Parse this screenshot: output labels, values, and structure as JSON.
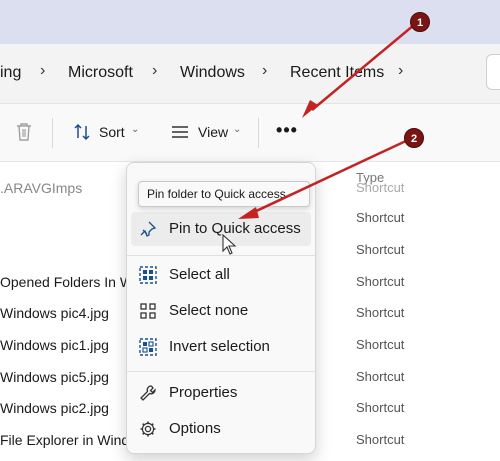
{
  "breadcrumb": {
    "items": [
      "ing",
      "Microsoft",
      "Windows",
      "Recent Items"
    ]
  },
  "toolbar": {
    "sort_label": "Sort",
    "view_label": "View",
    "more_label": "•••"
  },
  "columns": {
    "type": "Type"
  },
  "files": [
    {
      "name": "",
      "type": "Shortcut"
    },
    {
      "name": "",
      "type": "Shortcut"
    },
    {
      "name": "",
      "type": "Shortcut"
    },
    {
      "name": "Opened Folders In W",
      "type": "Shortcut"
    },
    {
      "name": "Windows pic4.jpg",
      "type": "Shortcut"
    },
    {
      "name": "Windows pic1.jpg",
      "type": "Shortcut"
    },
    {
      "name": "Windows pic5.jpg",
      "type": "Shortcut"
    },
    {
      "name": "Windows pic2.jpg",
      "type": "Shortcut"
    },
    {
      "name": "File Explorer in Windo",
      "type": "Shortcut"
    }
  ],
  "context_menu": {
    "tooltip": "Pin folder to Quick access",
    "items": [
      {
        "label": "Pin to Quick access",
        "icon": "pin-icon"
      },
      {
        "label": "Select all",
        "icon": "select-all-icon"
      },
      {
        "label": "Select none",
        "icon": "select-none-icon"
      },
      {
        "label": "Invert selection",
        "icon": "invert-selection-icon"
      },
      {
        "label": "Properties",
        "icon": "wrench-icon"
      },
      {
        "label": "Options",
        "icon": "gear-icon"
      }
    ]
  },
  "annotations": {
    "badge_1": "1",
    "badge_2": "2",
    "color": "#c42323"
  },
  "colors": {
    "accent": "#0063b1",
    "titlebar": "#dcdff0",
    "annotation": "#c42323"
  }
}
